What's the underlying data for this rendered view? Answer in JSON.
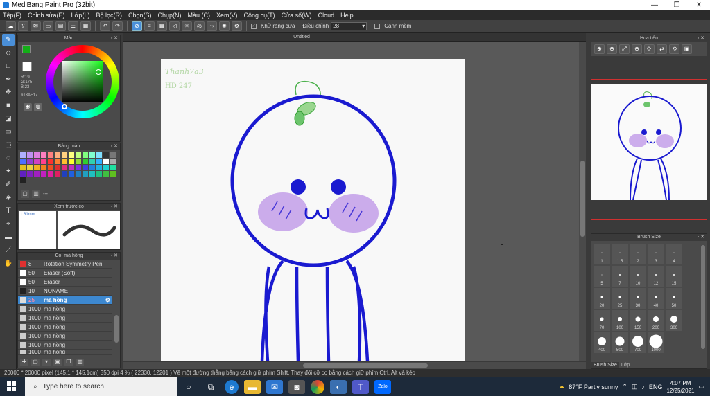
{
  "window": {
    "title": "MediBang Paint Pro (32bit)",
    "minimize": "—",
    "maximize": "❐",
    "close": "✕"
  },
  "menu": [
    "Tệp(F)",
    "Chỉnh sửa(E)",
    "Lớp(L)",
    "Bộ lọc(R)",
    "Chọn(S)",
    "Chụp(N)",
    "Màu (C)",
    "Xem(V)",
    "Công cụ(T)",
    "Cửa sổ(W)",
    "Cloud",
    "Help"
  ],
  "toolbar": {
    "antialias_label": "Khử răng cưa",
    "adjust_label": "Điều chỉnh",
    "adjust_value": "28",
    "canh_label": "Cạnh mềm"
  },
  "color_panel": {
    "title": "Màu",
    "r": "R:19",
    "g": "G:175",
    "b": "B:23",
    "hex": "#13AF17"
  },
  "palette_panel": {
    "title": "Bảng màu",
    "more": "---"
  },
  "preview_panel": {
    "title": "Xem trước cọ",
    "size": "1.81mm"
  },
  "brush_panel": {
    "title": "Cọ: má hồng",
    "items": [
      {
        "num": "8",
        "name": "Rotation Symmetry Pen",
        "color": "#e03030"
      },
      {
        "num": "50",
        "name": "Eraser (Soft)",
        "color": "#ffffff"
      },
      {
        "num": "50",
        "name": "Eraser",
        "color": "#ffffff"
      },
      {
        "num": "10",
        "name": "NONAME",
        "color": "#222222"
      },
      {
        "num": "25",
        "name": "má hồng",
        "color": "#a070e0"
      },
      {
        "num": "1000",
        "name": "má hồng",
        "color": "#cccccc"
      },
      {
        "num": "1000",
        "name": "má hồng",
        "color": "#cccccc"
      },
      {
        "num": "1000",
        "name": "má hồng",
        "color": "#cccccc"
      },
      {
        "num": "1000",
        "name": "má hồng",
        "color": "#cccccc"
      },
      {
        "num": "1000",
        "name": "má hồng",
        "color": "#cccccc"
      },
      {
        "num": "1000",
        "name": "má hồng",
        "color": "#cccccc"
      }
    ]
  },
  "document": {
    "tab": "Untitled",
    "signature1": "Thanh7a3",
    "signature2": "HD 247"
  },
  "navigator": {
    "title": "Hoa tiêu"
  },
  "brushsize_panel": {
    "title": "Brush Size",
    "sizes": [
      "1",
      "1.5",
      "2",
      "3",
      "4",
      "5",
      "7",
      "10",
      "12",
      "15",
      "20",
      "25",
      "30",
      "40",
      "50",
      "70",
      "100",
      "150",
      "200",
      "300",
      "400",
      "500",
      "700",
      "1000"
    ],
    "tab1": "Brush Size",
    "tab2": "Lớp"
  },
  "status": "20000 * 20000 pixel   (145.1 * 145.1cm)   350 dpi   4 %   ( 22330, 12201 )   Vẽ một đường thẳng bằng cách giữ phím Shift, Thay đổi cỡ cọ bằng cách giữ phím Ctrl, Alt và kéo",
  "taskbar": {
    "search": "Type here to search",
    "weather": "87°F  Partly sunny",
    "lang": "ENG",
    "time": "4:07 PM",
    "date": "12/25/2021"
  },
  "colors": {
    "primary": "#13AF17",
    "stroke": "#1a1ad0",
    "blush": "#a56de0"
  }
}
